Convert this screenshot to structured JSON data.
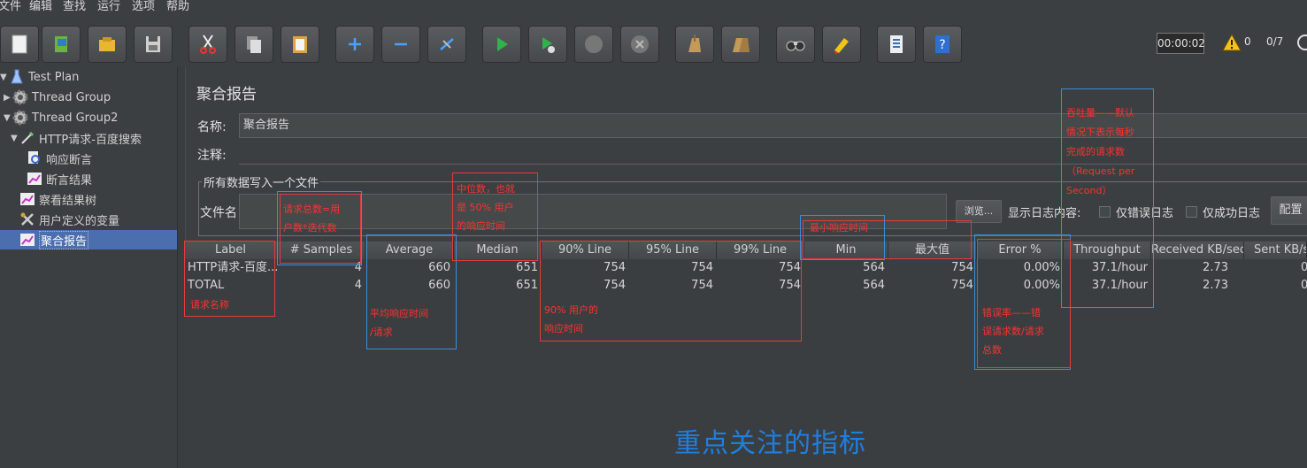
{
  "menubar": [
    "文件",
    "编辑",
    "查找",
    "运行",
    "选项",
    "帮助"
  ],
  "toolbar": {
    "icons": [
      "new-icon",
      "templates-icon",
      "open-icon",
      "save-icon",
      "cut-icon",
      "copy-icon",
      "paste-icon",
      "expand-icon",
      "collapse-icon",
      "toggle-icon",
      "start-icon",
      "start-no-pause-icon",
      "stop-icon",
      "shutdown-icon",
      "clear-icon",
      "clear-all-icon",
      "search-icon",
      "reset-search-icon",
      "function-helper-icon",
      "help-icon"
    ],
    "timer": "00:00:02",
    "warning_count": "0",
    "threads": "0/7"
  },
  "tree": [
    {
      "label": "Test Plan",
      "icon": "flask-icon"
    },
    {
      "label": "Thread Group",
      "icon": "gear-icon"
    },
    {
      "label": "Thread Group2",
      "icon": "gear-icon"
    },
    {
      "label": "HTTP请求-百度搜索",
      "icon": "pipette-icon"
    },
    {
      "label": "响应断言",
      "icon": "magnifier-icon"
    },
    {
      "label": "断言结果",
      "icon": "graph-icon"
    },
    {
      "label": "察看结果树",
      "icon": "graph-icon"
    },
    {
      "label": "用户定义的变量",
      "icon": "wrench-icon"
    },
    {
      "label": "聚合报告",
      "icon": "graph-icon"
    }
  ],
  "panel": {
    "title": "聚合报告",
    "name_label": "名称:",
    "name_value": "聚合报告",
    "comment_label": "注释:",
    "comment_value": "",
    "group_title": "所有数据写入一个文件",
    "file_label": "文件名",
    "file_value": "",
    "browse": "浏览...",
    "log_label": "显示日志内容:",
    "errors_only": "仅错误日志",
    "success_only": "仅成功日志",
    "config": "配置"
  },
  "table": {
    "headers": [
      "Label",
      "# Samples",
      "Average",
      "Median",
      "90% Line",
      "95% Line",
      "99% Line",
      "Min",
      "最大值",
      "Error %",
      "Throughput",
      "Received KB/sec",
      "Sent KB/sec"
    ],
    "rows": [
      [
        "HTTP请求-百度...",
        "4",
        "660",
        "651",
        "754",
        "754",
        "754",
        "564",
        "754",
        "0.00%",
        "37.1/hour",
        "2.73",
        "0"
      ],
      [
        "TOTAL",
        "4",
        "660",
        "651",
        "754",
        "754",
        "754",
        "564",
        "754",
        "0.00%",
        "37.1/hour",
        "2.73",
        "0"
      ]
    ]
  },
  "annotations": {
    "samples": [
      "请求总数=用",
      "户数*迭代数"
    ],
    "median": [
      "中位数，也就",
      "是 50% 用户",
      "的响应时间"
    ],
    "min": [
      "最小响应时间"
    ],
    "throughput": [
      "吞吐量——默认",
      "情况下表示每秒",
      "完成的请求数",
      "（Request per",
      "Second）"
    ],
    "label": [
      "请求名称"
    ],
    "average": [
      "平均响应时间",
      "/请求"
    ],
    "line90": [
      "90% 用户的",
      "响应时间"
    ],
    "error": [
      "错误率——错",
      "误请求数/请求",
      "总数"
    ],
    "headline": "重点关注的指标"
  },
  "colors": {
    "selection": "#4b6eaf",
    "annotation_red": "#e53b3b",
    "annotation_blue": "#3a8de0",
    "headline_blue": "#1e7fe0"
  }
}
